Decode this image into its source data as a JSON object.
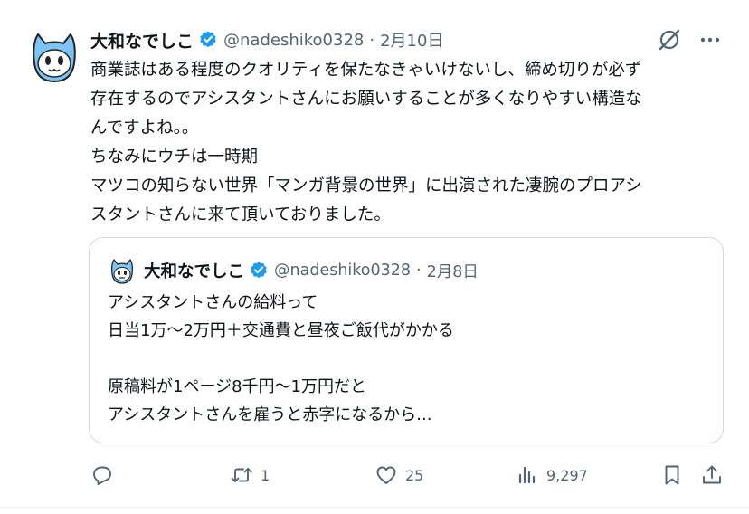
{
  "tweet": {
    "author_name": "大和なでしこ",
    "handle": "@nadeshiko0328",
    "separator": "·",
    "date": "2月10日",
    "lines": [
      "商業誌はある程度のクオリティを保たなきゃいけないし、締め切りが必ず",
      "存在するのでアシスタントさんにお願いすることが多くなりやすい構造な",
      "んですよね。。",
      "ちなみにウチは一時期",
      "マツコの知らない世界「マンガ背景の世界」に出演された凄腕のプロアシ",
      "スタントさんに来て頂いておりました。"
    ]
  },
  "quote": {
    "author_name": "大和なでしこ",
    "handle": "@nadeshiko0328",
    "separator": "·",
    "date": "2月8日",
    "lines": [
      "アシスタントさんの給料って",
      "日当1万〜2万円＋交通費と昼夜ご飯代がかかる",
      "",
      "原稿料が1ページ8千円〜1万円だと",
      "アシスタントさんを雇うと赤字になるから..."
    ]
  },
  "actions": {
    "reply_count": "",
    "retweet_count": "1",
    "like_count": "25",
    "views_count": "9,297"
  },
  "icons": {
    "verified": "verified-badge-icon",
    "grok": "grok-icon",
    "more": "more-icon",
    "reply": "reply-icon",
    "retweet": "retweet-icon",
    "like": "heart-icon",
    "views": "views-icon",
    "bookmark": "bookmark-icon",
    "share": "share-icon"
  },
  "colors": {
    "text": "#0f1419",
    "secondary": "#536471",
    "verified": "#1d9bf0",
    "border": "#cfd9de",
    "avatar_fill": "#7cc4f5"
  }
}
